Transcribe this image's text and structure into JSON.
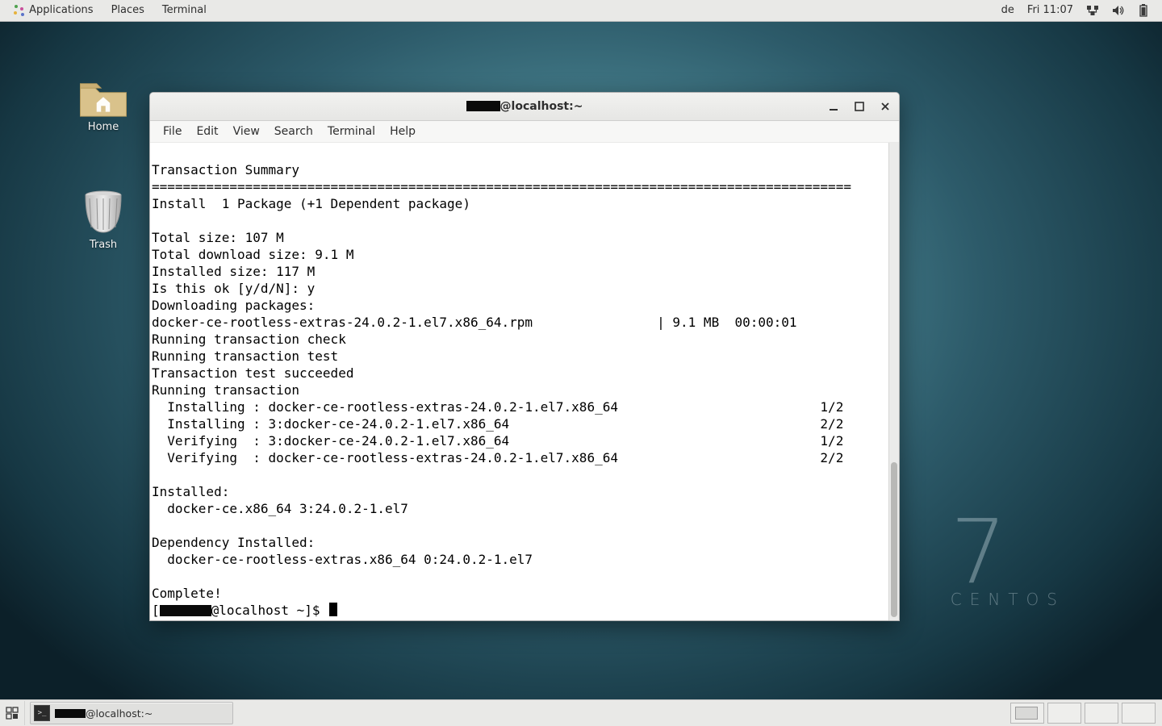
{
  "top_panel": {
    "applications": "Applications",
    "places": "Places",
    "app_open": "Terminal",
    "lang": "de",
    "clock": "Fri 11:07"
  },
  "desktop_icons": {
    "home": "Home",
    "trash": "Trash"
  },
  "watermark": {
    "seven": "7",
    "label": "CENTOS"
  },
  "terminal_window": {
    "title_suffix": "@localhost:~",
    "menus": {
      "file": "File",
      "edit": "Edit",
      "view": "View",
      "search": "Search",
      "terminal": "Terminal",
      "help": "Help"
    },
    "output_lines": [
      "",
      "Transaction Summary",
      "==========================================================================================",
      "Install  1 Package (+1 Dependent package)",
      "",
      "Total size: 107 M",
      "Total download size: 9.1 M",
      "Installed size: 117 M",
      "Is this ok [y/d/N]: y",
      "Downloading packages:",
      "docker-ce-rootless-extras-24.0.2-1.el7.x86_64.rpm                | 9.1 MB  00:00:01",
      "Running transaction check",
      "Running transaction test",
      "Transaction test succeeded",
      "Running transaction",
      "  Installing : docker-ce-rootless-extras-24.0.2-1.el7.x86_64                          1/2",
      "  Installing : 3:docker-ce-24.0.2-1.el7.x86_64                                        2/2",
      "  Verifying  : 3:docker-ce-24.0.2-1.el7.x86_64                                        1/2",
      "  Verifying  : docker-ce-rootless-extras-24.0.2-1.el7.x86_64                          2/2",
      "",
      "Installed:",
      "  docker-ce.x86_64 3:24.0.2-1.el7",
      "",
      "Dependency Installed:",
      "  docker-ce-rootless-extras.x86_64 0:24.0.2-1.el7",
      "",
      "Complete!"
    ],
    "prompt_prefix": "[",
    "prompt_suffix": "@localhost ~]$ "
  },
  "bottom_panel": {
    "task_suffix": "@localhost:~"
  }
}
